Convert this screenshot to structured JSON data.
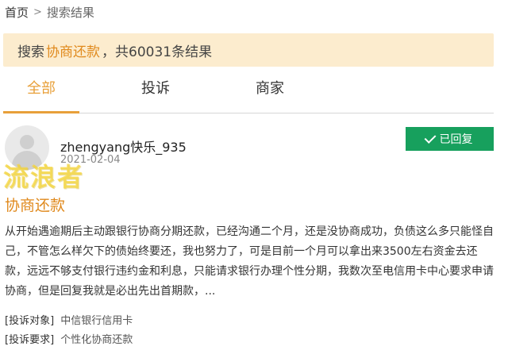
{
  "breadcrumb": {
    "home": "首页",
    "separator": ">",
    "current": "搜索结果"
  },
  "search_summary": {
    "prefix": "搜索",
    "keyword": "协商还款",
    "suffix": "，共60031条结果"
  },
  "tabs": [
    {
      "label": "全部",
      "active": true
    },
    {
      "label": "投诉",
      "active": false
    },
    {
      "label": "商家",
      "active": false
    }
  ],
  "post": {
    "username": "zhengyang快乐_935",
    "date": "2021-02-04",
    "status": "已回复",
    "title": "协商还款",
    "body": "从开始遇逾期后主动跟银行协商分期还款，已经沟通二个月，还是没协商成功，负债这么多只能怪自己，不管怎么样欠下的债始终要还，我也努力了，可是目前一个月可以拿出来3500左右资金去还款，远远不够支付银行违约金和利息，只能请求银行办理个性分期，我数次至电信用卡中心要求申请协商，但是回复我就是必出先出首期款，...",
    "complaint_target_label": "[投诉对象]",
    "complaint_target": "中信银行信用卡",
    "complaint_request_label": "[投诉要求]",
    "complaint_request": "个性化协商还款"
  },
  "watermark": "流浪者",
  "colors": {
    "accent": "#e8a03a",
    "keyword": "#e08a1e",
    "summary_bg": "#fcecce",
    "badge": "#17a05d"
  }
}
